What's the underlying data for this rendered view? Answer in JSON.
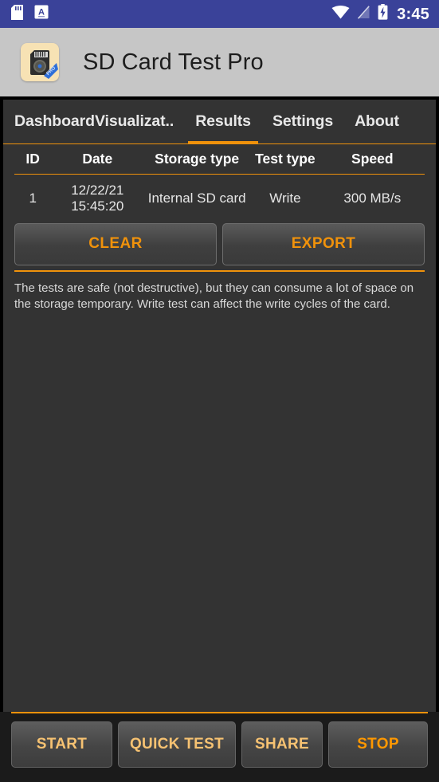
{
  "status_bar": {
    "icons_left": [
      "sd-card-icon",
      "letter-a-badge-icon"
    ],
    "icons_right": [
      "wifi-icon",
      "no-signal-icon",
      "battery-charging-icon"
    ],
    "time": "3:45",
    "background_color": "#3a4299"
  },
  "app_bar": {
    "icon": "app-logo-sd-card-pro-icon",
    "title": "SD Card Test Pro",
    "background_color": "#c6c6c6"
  },
  "tabs": {
    "items": [
      {
        "label": "Dashboard",
        "selected": false
      },
      {
        "label": "Visualizat..",
        "selected": false
      },
      {
        "label": "Results",
        "selected": true
      },
      {
        "label": "Settings",
        "selected": false
      },
      {
        "label": "About",
        "selected": false
      }
    ],
    "accent_color": "#f0920b"
  },
  "results_table": {
    "columns": [
      "ID",
      "Date",
      "Storage type",
      "Test type",
      "Speed"
    ],
    "rows": [
      {
        "id": "1",
        "date": "12/22/21 15:45:20",
        "storage_type": "Internal SD card",
        "test_type": "Write",
        "speed": "300 MB/s"
      }
    ]
  },
  "actions": {
    "clear_label": "CLEAR",
    "export_label": "EXPORT"
  },
  "info_text": "The tests are safe (not destructive), but they can consume a lot of space on the storage temporary. Write test can affect the write cycles of the card.",
  "bottom_bar": {
    "buttons": [
      {
        "label": "START",
        "state": "dim",
        "color": "#f6c272"
      },
      {
        "label": "QUICK TEST",
        "state": "dim",
        "color": "#f6c272"
      },
      {
        "label": "SHARE",
        "state": "dim",
        "color": "#f6c272"
      },
      {
        "label": "STOP",
        "state": "active",
        "color": "#ff9800"
      }
    ]
  }
}
